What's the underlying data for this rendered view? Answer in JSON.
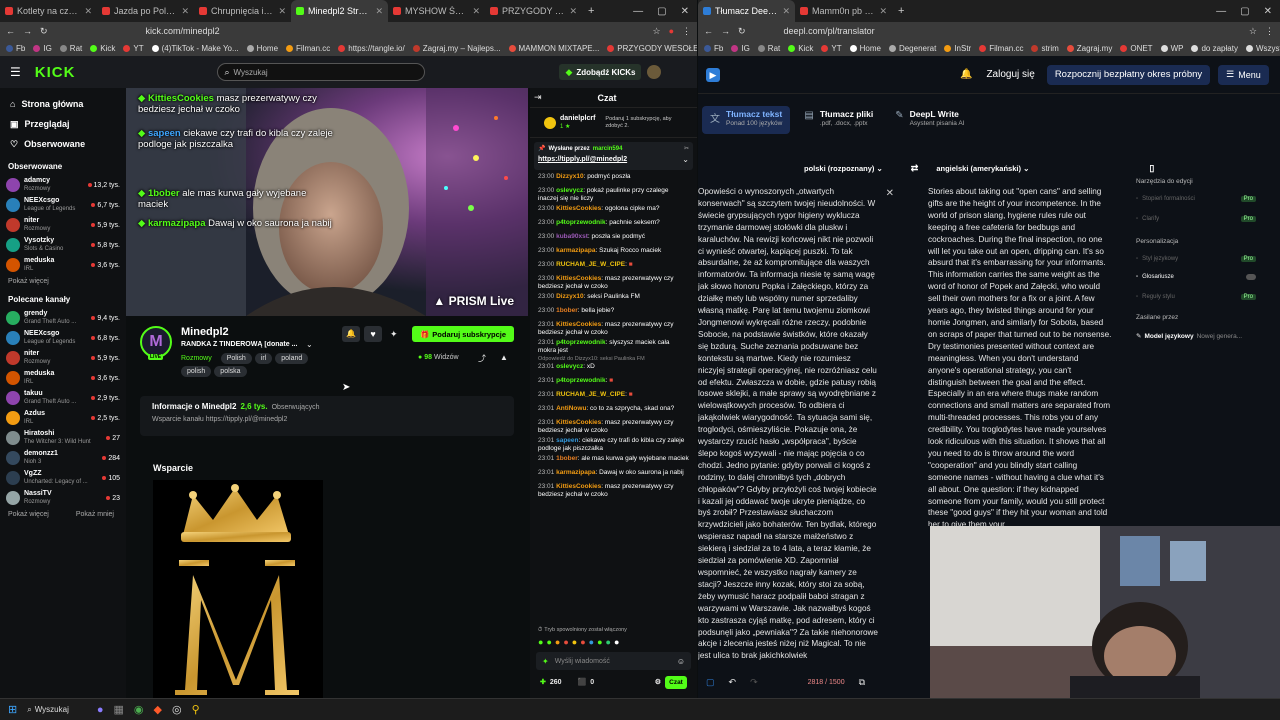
{
  "left_tabs": [
    {
      "title": "Kotlety na czarną godzinę",
      "color": "#e53935"
    },
    {
      "title": "Jazda po Polsku - wypadki",
      "color": "#e53935"
    },
    {
      "title": "Chrupnięcia i emocje od P",
      "color": "#e53935"
    },
    {
      "title": "Minedpl2 Stream - Wa",
      "color": "#53fc18",
      "active": true
    },
    {
      "title": "MYSHOW Święta bez śnieg",
      "color": "#e53935"
    },
    {
      "title": "PRZYGODY WESOŁEGO MA",
      "color": "#e53935"
    }
  ],
  "right_tabs": [
    {
      "title": "Tłumacz DeepL - najlepszy",
      "color": "#2e7dd7",
      "active": true
    },
    {
      "title": "Mamm0n pb 23:05 - YouTube",
      "color": "#e53935"
    }
  ],
  "left_url": "kick.com/minedpl2",
  "right_url": "deepl.com/pl/translator",
  "left_bookmarks": [
    "Fb",
    "IG",
    "Rat",
    "Kick",
    "YT",
    "(4)TikTok - Make Yo...",
    "Home",
    "Filman.cc",
    "https://tangle.io/",
    "Zagraj.my – Najleps...",
    "MAMMON MIXTAPE...",
    "PRZYGODY WESOŁE..."
  ],
  "right_bookmarks": [
    "Fb",
    "IG",
    "Rat",
    "Kick",
    "YT",
    "Home",
    "Degenerat",
    "InStr",
    "Filman.cc",
    "strim",
    "Zagraj.my",
    "ONET",
    "WP",
    "do zapłaty",
    "Wszystkie zakładki"
  ],
  "kick": {
    "logo": "KICK",
    "search_placeholder": "Wyszukaj",
    "cta": "Zdobądź KICKs",
    "nav": [
      {
        "label": "Strona główna",
        "icon": "home-icon"
      },
      {
        "label": "Przeglądaj",
        "icon": "browse-icon"
      },
      {
        "label": "Obserwowane",
        "icon": "heart-icon"
      }
    ],
    "followed_title": "Obserwowane",
    "followed": [
      {
        "name": "adamcy",
        "cat": "Rozmowy",
        "viewers": "13,2 tys.",
        "color": "#8e44ad"
      },
      {
        "name": "NEEXcsgo",
        "cat": "League of Legends",
        "viewers": "6,7 tys.",
        "color": "#2980b9"
      },
      {
        "name": "niter",
        "cat": "Rozmowy",
        "viewers": "5,9 tys.",
        "color": "#c0392b"
      },
      {
        "name": "Vysotzky",
        "cat": "Slots & Casino",
        "viewers": "5,8 tys.",
        "color": "#16a085"
      },
      {
        "name": "meduska",
        "cat": "IRL",
        "viewers": "3,6 tys.",
        "color": "#d35400"
      }
    ],
    "followed_more": "Pokaż więcej",
    "recommended_title": "Polecane kanały",
    "recommended": [
      {
        "name": "grendy",
        "cat": "Grand Theft Auto ...",
        "viewers": "9,4 tys.",
        "color": "#27ae60"
      },
      {
        "name": "NEEXcsgo",
        "cat": "League of Legends",
        "viewers": "6,8 tys.",
        "color": "#2980b9"
      },
      {
        "name": "niter",
        "cat": "Rozmowy",
        "viewers": "5,9 tys.",
        "color": "#c0392b"
      },
      {
        "name": "meduska",
        "cat": "IRL",
        "viewers": "3,6 tys.",
        "color": "#d35400"
      },
      {
        "name": "takuu",
        "cat": "Grand Theft Auto ...",
        "viewers": "2,9 tys.",
        "color": "#8e44ad"
      },
      {
        "name": "Azdus",
        "cat": "IRL",
        "viewers": "2,5 tys.",
        "color": "#f39c12"
      },
      {
        "name": "Hiratoshi",
        "cat": "The Witcher 3: Wild Hunt",
        "viewers": "27",
        "color": "#7f8c8d"
      },
      {
        "name": "demonzz1",
        "cat": "Nioh 3",
        "viewers": "284",
        "color": "#34495e"
      },
      {
        "name": "VgZZ",
        "cat": "Uncharted: Legacy of ...",
        "viewers": "105",
        "color": "#2c3e50"
      },
      {
        "name": "NassiTV",
        "cat": "Rozmowy",
        "viewers": "23",
        "color": "#95a5a6"
      }
    ],
    "rec_more": "Pokaż więcej",
    "rec_less": "Pokaż mniej",
    "overlay": [
      {
        "name": "KittiesCookies",
        "text": " masz prezerwatywy czy bedziesz jechał w czoko"
      },
      {
        "name": "sapeen",
        "text": " ciekawe czy trafi do kibla czy zaleje podloge jak piszczalka"
      },
      {
        "name": "1bober",
        "text": " ale mas kurwa gały wyjebane maciek"
      },
      {
        "name": "karmazipapa",
        "text": " Dawaj w oko saurona ja nabij"
      }
    ],
    "watermark": "PRISM Live",
    "channel": {
      "name": "Minedpl2",
      "title": "RANDKA Z TINDERÓWĄ [donate ...",
      "category": "Rozmowy",
      "tags": [
        "Polish",
        "irl",
        "poland"
      ],
      "tags2": [
        "polish",
        "polska"
      ],
      "subscribe": "Podaruj subskrypcje",
      "viewers": "98",
      "viewers_label": "Widzów",
      "about_title": "Informacje o Minedpl2",
      "followers": "2,6 tys.",
      "followers_label": "Obserwujących",
      "about_text": "Wsparcie kanału https://tipply.pl/@minedpl2",
      "support_title": "Wsparcie"
    },
    "chat": {
      "title": "Czat",
      "top_user": "danielplcrf",
      "top_text": "Podaruj 1 subskrypcję, aby zdobyć 2.",
      "pinned_from": "Wysłane przez",
      "pinned_user": "marcin594",
      "pinned_link": "https://tipply.pl/@minedpl2",
      "messages": [
        {
          "time": "23:00",
          "user": "Dizzyx10",
          "color": "#f39c12",
          "text": "podmyć poszła"
        },
        {
          "time": "23:00",
          "user": "oslevycz",
          "color": "#53fc18",
          "text": "pokaż paulinke przy czalege inaczej się nie liczy"
        },
        {
          "time": "23:00",
          "user": "KittiesCookies",
          "color": "#f39c12",
          "text": "ogolona cipke ma?"
        },
        {
          "time": "23:00",
          "user": "p4toprzewodnik",
          "color": "#53fc18",
          "text": "pachnie seksem?"
        },
        {
          "time": "23:00",
          "user": "kuba90xst",
          "color": "#9b59b6",
          "text": "poszła sie podmyć"
        },
        {
          "time": "23:00",
          "user": "karmazipapa",
          "color": "#f39c12",
          "text": "Szukaj Rocco maciek"
        },
        {
          "time": "23:00",
          "user": "RUCHAM_JE_W_CIPE",
          "color": "#f1c40f",
          "text": ""
        },
        {
          "time": "23:00",
          "user": "KittiesCookies",
          "color": "#f39c12",
          "text": "masz prezerwatywy czy bedziesz jechał w czoko"
        },
        {
          "time": "23:00",
          "user": "Dizzyx10",
          "color": "#f39c12",
          "text": "seksi Paulinka FM"
        },
        {
          "time": "23:00",
          "user": "1bober",
          "color": "#e67e22",
          "text": "bella jebie?"
        },
        {
          "time": "23:01",
          "user": "KittiesCookies",
          "color": "#f39c12",
          "text": "masz prezerwatywy czy bedziesz jechał w czoko"
        },
        {
          "time": "23:01",
          "user": "p4toprzewodnik",
          "color": "#53fc18",
          "text": "slyszysz maciek cała mokra jest"
        },
        {
          "time": "23:01",
          "user": "oslevycz",
          "color": "#53fc18",
          "text": "xD"
        },
        {
          "time": "23:01",
          "user": "p4toprzewodnik",
          "color": "#53fc18",
          "text": ""
        },
        {
          "time": "23:01",
          "user": "RUCHAM_JE_W_CIPE",
          "color": "#f1c40f",
          "text": ""
        },
        {
          "time": "23:01",
          "user": "AntiNowu",
          "color": "#f39c12",
          "text": "co to za szprycha, skad ona?"
        },
        {
          "time": "23:01",
          "user": "KittiesCookies",
          "color": "#f39c12",
          "text": "masz prezerwatywy czy bedziesz jechał w czoko"
        },
        {
          "time": "23:01",
          "user": "sapeen",
          "color": "#3498db",
          "text": "ciekawe czy trafi do kibla czy zaleje podloge jak piszczalka"
        },
        {
          "time": "23:01",
          "user": "1bober",
          "color": "#e67e22",
          "text": "ale mas kurwa gały wyjebane maciek"
        },
        {
          "time": "23:01",
          "user": "karmazipapa",
          "color": "#f39c12",
          "text": "Dawaj w oko saurona ja nabij"
        },
        {
          "time": "23:01",
          "user": "KittiesCookies",
          "color": "#f39c12",
          "text": "masz prezerwatywy czy bedziesz jechał w czoko"
        }
      ],
      "reply_note": "Odpowiedź do Dizzyx10: seksi Paulinka FM",
      "slow_mode": "Tryb spowolniony został włączony",
      "input_placeholder": "Wyślij wiadomość",
      "points": "260",
      "count": "0",
      "send": "Czat"
    }
  },
  "deepl": {
    "login": "Zaloguj się",
    "trial": "Rozpocznij bezpłatny okres próbny",
    "menu": "Menu",
    "tabs": [
      {
        "label": "Tłumacz tekst",
        "sub": "Ponad 100 języków"
      },
      {
        "label": "Tłumacz pliki",
        "sub": ".pdf, .docx, .pptx"
      },
      {
        "label": "DeepL Write",
        "sub": "Asystent pisania AI"
      }
    ],
    "src_lang": "polski (rozpoznany)",
    "tgt_lang": "angielski (amerykański)",
    "source": "Opowieści o wynoszonych „otwartych konserwach\" są szczytem twojej nieudolności. W świecie grypsujących rygor higieny wyklucza trzymanie darmowej stołówki dla pluskw i karaluchów. Na rewizji końcowej nikt nie pozwoli ci wynieść otwartej, kapiącej puszki. To tak absurdalne, że aż kompromitujące dla waszych informatorów. Ta informacja niesie tę samą wagę jak słowo honoru Popka i Załęckiego, którzy za działkę mety lub wspólny numer sprzedaliby własną matkę. Parę lat temu twojemu ziomkowi Jongmenowi wykręcali różne rzeczy, podobnie Sobocie, na podstawie świstków, które okazały się bzdurą. Suche zeznania podsuwane bez kontekstu są martwe. Kiedy nie rozumiesz niczyjej strategii operacyjnej, nie rozróżniasz celu od efektu. Zwłaszcza w dobie, gdzie patusy robią losowe sklejki, a małe sprawy są wyodrębniane z wielowątkowych procesów. To odbiera ci jakąkolwiek wiarygodność. Ta sytuacja sami się, troglodyci, ośmieszyliście. Pokazuje ona, że wystarczy rzucić hasło „współpraca\", byście ślepo kogoś wyzywali - nie mając pojęcia o co chodzi. Jedno pytanie: gdyby porwali ci kogoś z rodziny, to dalej chroniłbyś tych „dobrych chłopaków\"? Gdyby przyłożyli coś twojej kobiecie i kazali jej oddawać twoje ukryte pieniądze, co byś zrobił? Przestawiasz słuchaczom krzywdzicieli jako bohaterów. Ten bydlak, którego wspierasz napadł na starsze małżeństwo z siekierą i siedział za to 4 lata, a teraz kłamie, że siedział za pomówienie XD. Zapomniał wspomnieć, że wszystko nagrały kamery ze stacji? Jeszcze inny kozak, który stoi za sobą, żeby wymusić haracz podpalił baboi stragan z warzywami w Warszawie. Jak nazwałbyś kogoś kto zastrasza cyjąś matkę, pod adresem, który ci podsunęli jako „pewniaka\"? Za takie niehonorowe akcje i zlecenia jesteś niżej niż Magical. To nie jest ulica to brak jakichkolwiek",
    "target": "Stories about taking out \"open cans\" and selling gifts are the height of your incompetence. In the world of prison slang, hygiene rules rule out keeping a free cafeteria for bedbugs and cockroaches. During the final inspection, no one will let you take out an open, dripping can. It's so absurd that it's embarrassing for your informants. This information carries the same weight as the word of honor of Popek and Załęcki, who would sell their own mothers for a fix or a joint. A few years ago, they twisted things around for your homie Jongmen, and similarly for Sobota, based on scraps of paper that turned out to be nonsense. Dry testimonies presented without context are meaningless. When you don't understand anyone's operational strategy, you can't distinguish between the goal and the effect. Especially in an era where thugs make random connections and small matters are separated from multi-threaded processes. This robs you of any credibility. You troglodytes have made yourselves look ridiculous with this situation. It shows that all you need to do is throw around the word \"cooperation\" and you blindly start calling someone names - without having a clue what it's all about. One question: if they kidnapped someone from your family, would you still protect these \"good guys\" if they hit your woman and told her to give them your",
    "char_count": "2818 / 1500",
    "side_headers": [
      "Narzędzia do edycji",
      "Personalizacja",
      "Zasilane przez"
    ],
    "side_items": [
      {
        "label": "Stopień formalności",
        "badge": "Pro"
      },
      {
        "label": "Clarify",
        "badge": "Pro"
      },
      {
        "label": "Styl językowy",
        "badge": "Pro"
      },
      {
        "label": "Glosariusze",
        "badge": ""
      },
      {
        "label": "Reguły stylu",
        "badge": "Pro"
      }
    ],
    "model_label": "Model językowy",
    "model_value": "Nowej genera..."
  },
  "taskbar": {
    "search": "Wyszukaj"
  }
}
